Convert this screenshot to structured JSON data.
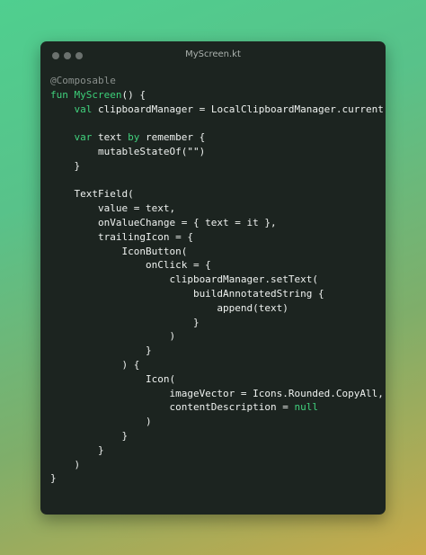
{
  "window": {
    "title": "MyScreen.kt"
  },
  "code": {
    "lines": [
      [
        {
          "t": "@Composable",
          "c": "anno"
        }
      ],
      [
        {
          "t": "fun",
          "c": "kw"
        },
        {
          "t": " ",
          "c": "plain"
        },
        {
          "t": "MyScreen",
          "c": "fn"
        },
        {
          "t": "() {",
          "c": "plain"
        }
      ],
      [
        {
          "t": "    ",
          "c": "plain"
        },
        {
          "t": "val",
          "c": "kw"
        },
        {
          "t": " clipboardManager = LocalClipboardManager.current",
          "c": "plain"
        }
      ],
      [],
      [
        {
          "t": "    ",
          "c": "plain"
        },
        {
          "t": "var",
          "c": "kw"
        },
        {
          "t": " text ",
          "c": "plain"
        },
        {
          "t": "by",
          "c": "kw"
        },
        {
          "t": " remember {",
          "c": "plain"
        }
      ],
      [
        {
          "t": "        mutableStateOf(\"\")",
          "c": "plain"
        }
      ],
      [
        {
          "t": "    }",
          "c": "plain"
        }
      ],
      [],
      [
        {
          "t": "    TextField(",
          "c": "plain"
        }
      ],
      [
        {
          "t": "        value = text,",
          "c": "plain"
        }
      ],
      [
        {
          "t": "        onValueChange = { text = it },",
          "c": "plain"
        }
      ],
      [
        {
          "t": "        trailingIcon = {",
          "c": "plain"
        }
      ],
      [
        {
          "t": "            IconButton(",
          "c": "plain"
        }
      ],
      [
        {
          "t": "                onClick = {",
          "c": "plain"
        }
      ],
      [
        {
          "t": "                    clipboardManager.setText(",
          "c": "plain"
        }
      ],
      [
        {
          "t": "                        buildAnnotatedString {",
          "c": "plain"
        }
      ],
      [
        {
          "t": "                            append(text)",
          "c": "plain"
        }
      ],
      [
        {
          "t": "                        }",
          "c": "plain"
        }
      ],
      [
        {
          "t": "                    )",
          "c": "plain"
        }
      ],
      [
        {
          "t": "                }",
          "c": "plain"
        }
      ],
      [
        {
          "t": "            ) {",
          "c": "plain"
        }
      ],
      [
        {
          "t": "                Icon(",
          "c": "plain"
        }
      ],
      [
        {
          "t": "                    imageVector = Icons.Rounded.CopyAll,",
          "c": "plain"
        }
      ],
      [
        {
          "t": "                    contentDescription = ",
          "c": "plain"
        },
        {
          "t": "null",
          "c": "kw"
        }
      ],
      [
        {
          "t": "                )",
          "c": "plain"
        }
      ],
      [
        {
          "t": "            }",
          "c": "plain"
        }
      ],
      [
        {
          "t": "        }",
          "c": "plain"
        }
      ],
      [
        {
          "t": "    )",
          "c": "plain"
        }
      ],
      [
        {
          "t": "}",
          "c": "plain"
        }
      ]
    ]
  },
  "colors": {
    "editor_background": "#1c2420",
    "keyword": "#41d17d",
    "annotation": "#8a908d",
    "text": "#eef1ef"
  }
}
